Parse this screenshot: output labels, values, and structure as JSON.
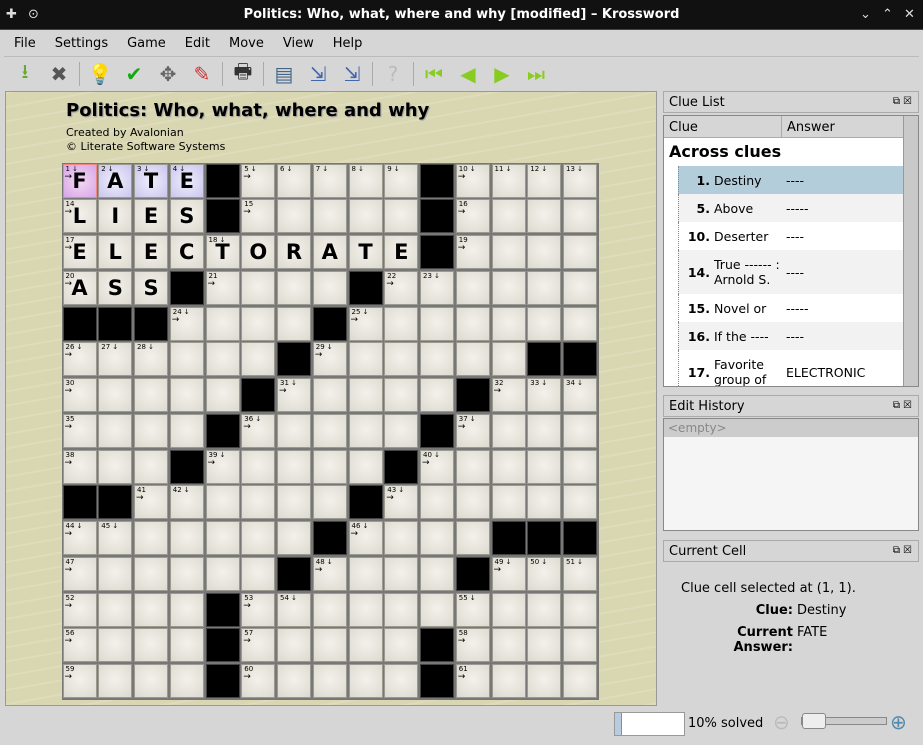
{
  "window": {
    "title": "Politics: Who, what, where and why [modified] – Krossword"
  },
  "menu": [
    "File",
    "Settings",
    "Game",
    "Edit",
    "Move",
    "View",
    "Help"
  ],
  "toolbar": [
    {
      "icon": "save-icon",
      "glyph": "⭳",
      "color": "#6a3"
    },
    {
      "icon": "close-icon",
      "glyph": "✖",
      "color": "#555"
    },
    "sep",
    {
      "icon": "hint-bulb-icon",
      "glyph": "💡",
      "color": "#4b4"
    },
    {
      "icon": "check-icon",
      "glyph": "✔",
      "color": "#1a1"
    },
    {
      "icon": "solve-icon",
      "glyph": "✥",
      "color": "#666"
    },
    {
      "icon": "clear-eraser-icon",
      "glyph": "✎",
      "color": "#c33"
    },
    "sep",
    {
      "icon": "print-icon",
      "glyph": "🖶",
      "color": "#333"
    },
    "sep",
    {
      "icon": "document-icon",
      "glyph": "▤",
      "color": "#468"
    },
    {
      "icon": "clue-prev-icon",
      "glyph": "⇲",
      "color": "#46a"
    },
    {
      "icon": "clue-next-icon",
      "glyph": "⇲",
      "color": "#46a"
    },
    "sep",
    {
      "icon": "help-icon",
      "glyph": "?",
      "color": "#bbb"
    },
    "sep",
    {
      "icon": "first-icon",
      "glyph": "⏮",
      "color": "#8c2"
    },
    {
      "icon": "back-icon",
      "glyph": "◀",
      "color": "#8c2"
    },
    {
      "icon": "forward-icon",
      "glyph": "▶",
      "color": "#8c2"
    },
    {
      "icon": "last-icon",
      "glyph": "⏭",
      "color": "#8c2"
    }
  ],
  "puzzle": {
    "title": "Politics: Who, what, where and why",
    "author": "Created by Avalonian",
    "copyright": "© Literate Software Systems",
    "grid": [
      "FATE#.....#....",
      "LIES#.....#....",
      "ELECTORATE#....",
      "ASS#....#......",
      "###....#.......",
      "......#......##",
      ".....#.....#...",
      "....#.....#....",
      "...#.....#.....",
      "##......#......",
      ".......#....###",
      "......#....#...",
      "....#..........",
      "....#.....#....",
      "....#.....#...."
    ],
    "selected": {
      "row": 0,
      "col": 0
    },
    "highlighted_word": {
      "row": 0,
      "cols": [
        0,
        1,
        2,
        3
      ]
    }
  },
  "clue_list": {
    "title": "Clue List",
    "col_clue": "Clue",
    "col_answer": "Answer",
    "section": "Across clues",
    "clues": [
      {
        "num": "1.",
        "text": "Destiny",
        "answer": "----",
        "selected": true
      },
      {
        "num": "5.",
        "text": "Above",
        "answer": "-----"
      },
      {
        "num": "10.",
        "text": "Deserter",
        "answer": "----"
      },
      {
        "num": "14.",
        "text": "True ------ : Arnold S.",
        "answer": "----",
        "tall": true
      },
      {
        "num": "15.",
        "text": "Novel or",
        "answer": "-----"
      },
      {
        "num": "16.",
        "text": "If the ----",
        "answer": "----"
      },
      {
        "num": "17.",
        "text": "Favorite group of",
        "answer": "ELECTRONIC",
        "tall": true
      }
    ]
  },
  "edit_history": {
    "title": "Edit History",
    "empty": "<empty>"
  },
  "current_cell": {
    "title": "Current Cell",
    "info": "Clue cell selected at (1, 1).",
    "clue_label": "Clue:",
    "clue": "Destiny",
    "answer_label": "Current Answer:",
    "answer": "FATE"
  },
  "status": {
    "solved_text": "10% solved",
    "solved_fraction": 0.1
  }
}
